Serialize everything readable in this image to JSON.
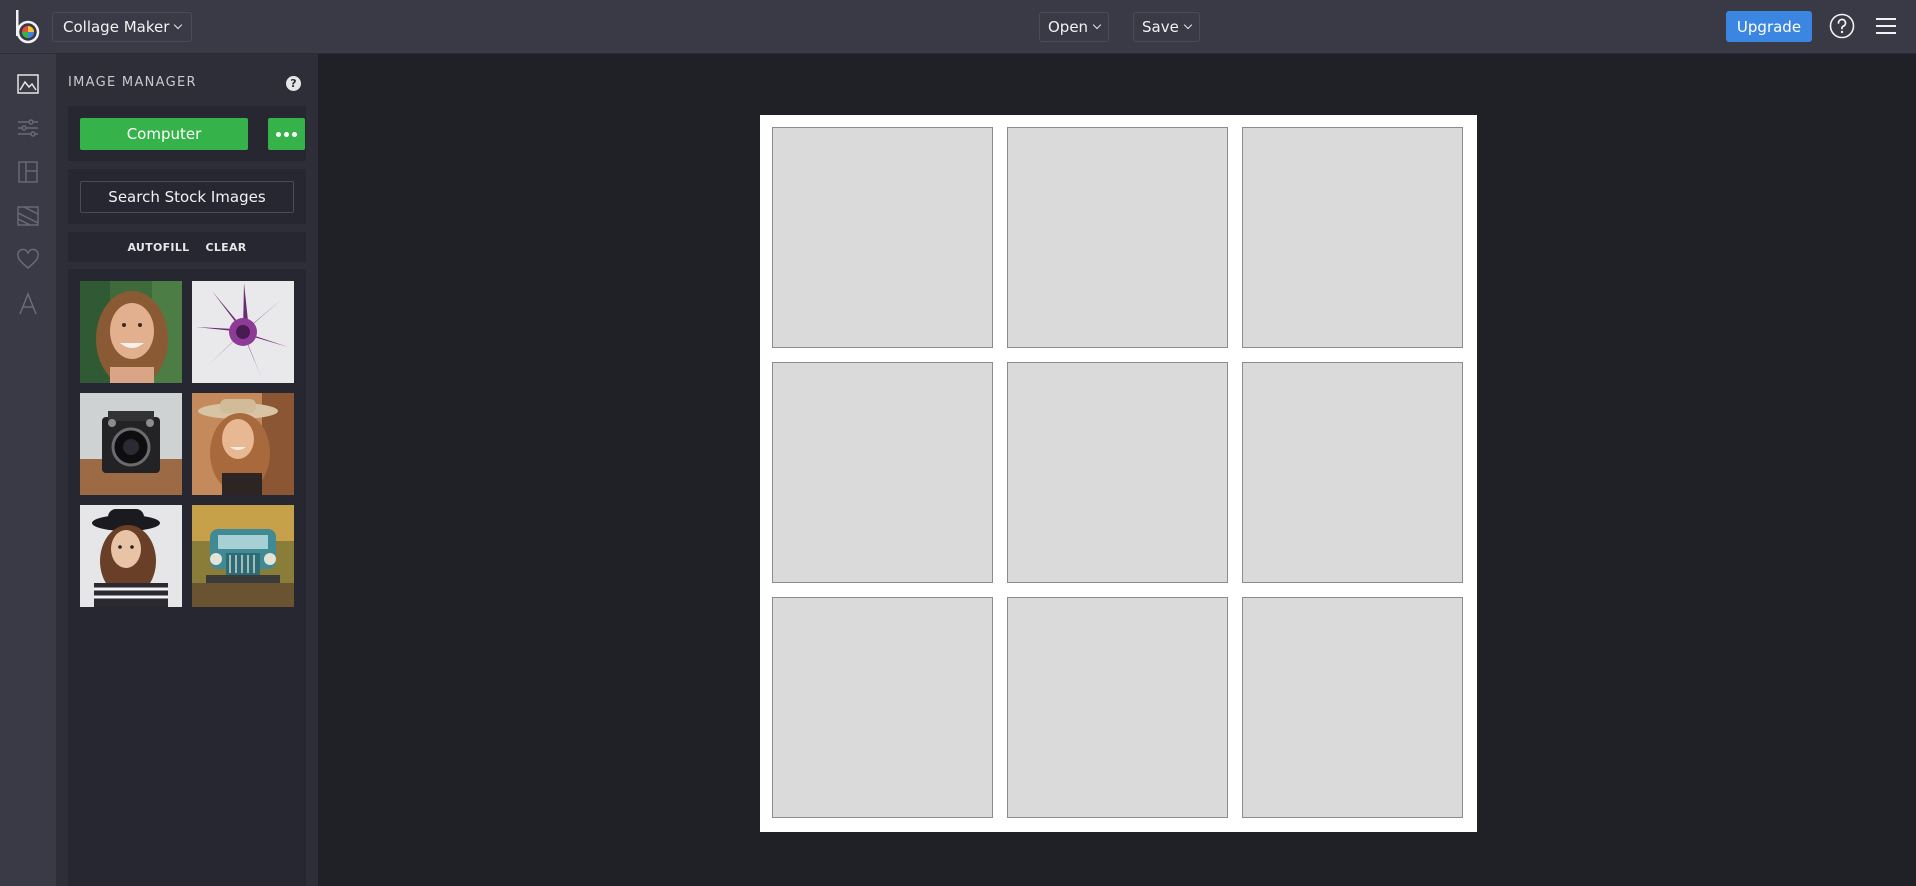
{
  "app": {
    "menu_label": "Collage Maker"
  },
  "toolbar": {
    "open_label": "Open",
    "save_label": "Save",
    "upgrade_label": "Upgrade"
  },
  "colors": {
    "accent_blue": "#3a86e0",
    "accent_green": "#36b24a",
    "topbar": "#393a45",
    "background": "#202126"
  },
  "rail": {
    "icons": [
      "image-manager-icon",
      "adjust-icon",
      "layout-icon",
      "background-icon",
      "favorites-icon",
      "text-icon"
    ]
  },
  "panel": {
    "title": "IMAGE MANAGER",
    "help_glyph": "?",
    "computer_label": "Computer",
    "stock_label": "Search Stock Images",
    "autofill_label": "AUTOFILL",
    "clear_label": "CLEAR",
    "thumbnails": [
      "smiling-woman-photo",
      "purple-succulent-photo",
      "vintage-camera-photo",
      "woman-in-hat-photo",
      "woman-black-hat-photo",
      "vintage-truck-photo"
    ]
  },
  "collage": {
    "rows": 3,
    "columns": 3,
    "cell_count": 9
  }
}
